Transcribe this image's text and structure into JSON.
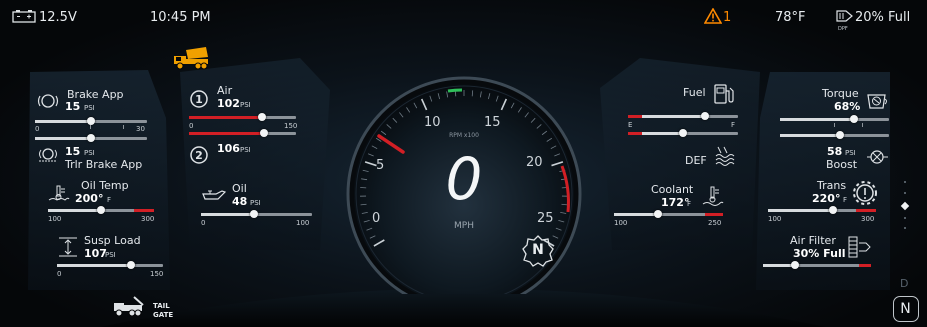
{
  "status": {
    "battery": "12.5V",
    "time": "10:45 PM",
    "warning_count": "1",
    "temperature": "78°F",
    "dpf_fill": "20% Full",
    "dpf_label": "DPF"
  },
  "speedo": {
    "speed": "0",
    "unit": "MPH",
    "rpm_label": "RPM x100",
    "ticks": [
      "0",
      "5",
      "10",
      "15",
      "20",
      "25"
    ],
    "gear": "N"
  },
  "left": {
    "brake_app": {
      "label": "Brake App",
      "value": "15",
      "unit": "PSI",
      "min": "0",
      "max": "30",
      "level": 0.5
    },
    "trlr_brake": {
      "label": "Trlr Brake App",
      "value": "15",
      "unit": "PSI",
      "level": 0.5
    },
    "oil_temp": {
      "label": "Oil Temp",
      "value": "200°",
      "unit": "F",
      "min": "100",
      "max": "300",
      "level": 0.5
    },
    "susp_load": {
      "label": "Susp Load",
      "value": "107",
      "unit": "PSI",
      "min": "0",
      "max": "150",
      "level": 0.7
    },
    "air1": {
      "label": "Air",
      "value": "102",
      "unit": "PSI",
      "min": "0",
      "max": "150",
      "level": 0.68
    },
    "air2": {
      "value": "106",
      "unit": "PSI",
      "level": 0.7
    },
    "oil": {
      "label": "Oil",
      "value": "48",
      "unit": "PSI",
      "min": "0",
      "max": "100",
      "level": 0.48
    },
    "tail_gate": "TAIL GATE"
  },
  "right": {
    "fuel": {
      "label": "Fuel",
      "empty": "E",
      "full": "F",
      "level": 0.7
    },
    "def": {
      "label": "DEF",
      "level": 0.5
    },
    "coolant": {
      "label": "Coolant",
      "value": "172°",
      "unit": "F",
      "min": "100",
      "max": "250",
      "level": 0.48
    },
    "torque": {
      "label": "Torque",
      "value": "68%",
      "level": 0.68
    },
    "boost": {
      "label": "Boost",
      "value": "58",
      "unit": "PSI",
      "level": 0.55
    },
    "trans": {
      "label": "Trans",
      "value": "220°",
      "unit": "F",
      "min": "100",
      "max": "300",
      "level": 0.6
    },
    "air_filter": {
      "label": "Air Filter",
      "value": "30% Full",
      "level": 0.3
    }
  },
  "corner": {
    "d_label": "D",
    "gear": "N"
  },
  "colors": {
    "accent_red": "#d21f25",
    "warning": "#ff8a00",
    "truck_icon": "#f0a000",
    "green": "#2fbf5a"
  }
}
